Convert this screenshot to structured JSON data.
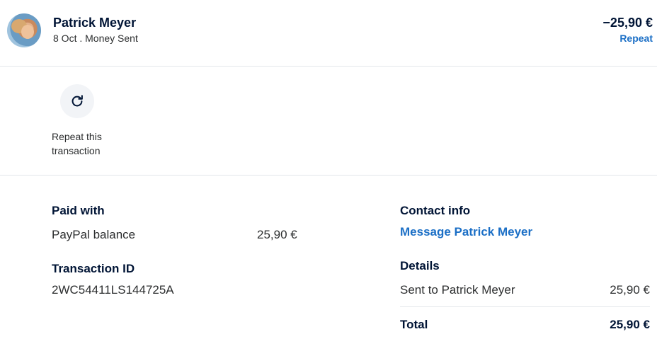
{
  "header": {
    "name": "Patrick Meyer",
    "subtitle": "8 Oct . Money Sent",
    "amount": "−25,90 €",
    "repeat_label": "Repeat"
  },
  "action": {
    "label_line1": "Repeat this",
    "label_line2": "transaction"
  },
  "paid_with": {
    "heading": "Paid with",
    "method": "PayPal balance",
    "amount": "25,90 €"
  },
  "transaction": {
    "heading": "Transaction ID",
    "id": "2WC54411LS144725A"
  },
  "contact": {
    "heading": "Contact info",
    "message_link": "Message Patrick Meyer"
  },
  "details": {
    "heading": "Details",
    "sent_label": "Sent to Patrick Meyer",
    "sent_amount": "25,90 €",
    "total_label": "Total",
    "total_amount": "25,90 €"
  },
  "colors": {
    "link": "#1b6fc6",
    "text": "#001435",
    "icon_bg": "#f2f4f7"
  },
  "icons": {
    "repeat": "refresh-icon"
  }
}
